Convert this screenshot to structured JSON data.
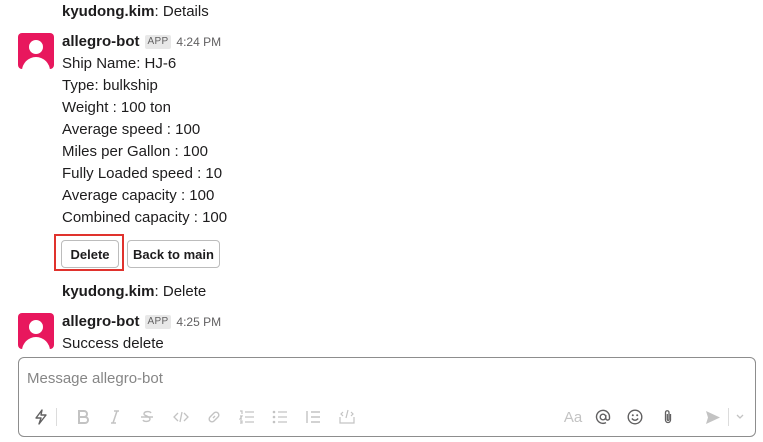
{
  "messages": [
    {
      "sender": "kyudong.kim",
      "text": "Details"
    },
    {
      "sender": "allegro-bot",
      "badge": "APP",
      "time": "4:24 PM",
      "lines": [
        "Ship Name: HJ-6",
        "Type: bulkship",
        "Weight : 100 ton",
        "Average speed : 100",
        "Miles per Gallon : 100",
        "Fully Loaded speed : 10",
        "Average capacity : 100",
        "Combined capacity : 100"
      ],
      "buttons": {
        "delete": "Delete",
        "back": "Back to main"
      }
    },
    {
      "sender": "kyudong.kim",
      "text": "Delete"
    },
    {
      "sender": "allegro-bot",
      "badge": "APP",
      "time": "4:25 PM",
      "lines": [
        "Success delete"
      ]
    }
  ],
  "composer": {
    "placeholder": "Message allegro-bot",
    "format_label": "Aa",
    "icons": [
      "shortcuts-icon",
      "bold-icon",
      "italic-icon",
      "strikethrough-icon",
      "code-icon",
      "link-icon",
      "ordered-list-icon",
      "bulleted-list-icon",
      "blockquote-icon",
      "code-block-icon",
      "format-icon",
      "mention-icon",
      "emoji-icon",
      "attach-icon",
      "send-icon",
      "send-options-icon"
    ]
  },
  "colors": {
    "highlight": "#e0322d",
    "avatar": "#e8175d"
  }
}
